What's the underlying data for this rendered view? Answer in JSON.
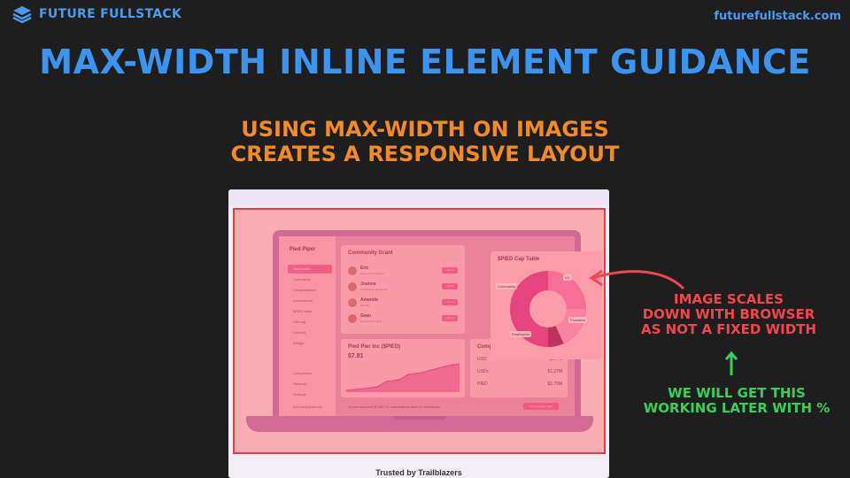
{
  "brand": {
    "name": "FUTURE FULLSTACK",
    "url": "futurefullstack.com"
  },
  "slide": {
    "title": "MAX-WIDTH INLINE ELEMENT GUIDANCE",
    "subtitle_line1": "USING MAX-WIDTH ON IMAGES",
    "subtitle_line2": "CREATES A RESPONSIVE LAYOUT",
    "note1": [
      "IMAGE SCALES",
      "DOWN WITH BROWSER",
      "AS NOT A FIXED WIDTH"
    ],
    "note2": [
      "WE WILL GET THIS",
      "WORKING LATER WITH %"
    ]
  },
  "colors": {
    "background": "#1e1e1e",
    "title": "#3b95f0",
    "subtitle": "#f28a26",
    "note_red": "#f2454f",
    "note_green": "#38d05a"
  },
  "screenshot": {
    "app_name": "Pied Piper",
    "nav": [
      "Dashboard",
      "Community",
      "Compensation",
      "Investments",
      "$PIED table",
      "Offering",
      "Content",
      "Widget",
      "Compliance",
      "Reviews",
      "Settings"
    ],
    "user": {
      "email": "john.doe@gmail.com",
      "role": "Administrator"
    },
    "grant": {
      "title": "Community Grant",
      "people": [
        {
          "name": "Eric",
          "desc": "Microsoft Contractor",
          "action": "Send"
        },
        {
          "name": "Joanna",
          "desc": "Outstanding developer",
          "action": "Send"
        },
        {
          "name": "Amanda",
          "desc": "Security",
          "action": "Send"
        },
        {
          "name": "Sean",
          "desc": "Completed 5 tasks",
          "action": "Send"
        }
      ]
    },
    "cap_table": {
      "title": "$PIED Cap Table",
      "labels": [
        "Community",
        "VC",
        "Founders",
        "Employees"
      ]
    },
    "pied": {
      "title": "Pied Pier Inc ($PIED)",
      "value": "$7.81",
      "ticks": [
        "Feb 16",
        "Jan 13",
        "Feb 13",
        "Mar 13",
        "Apr 13",
        "May 13"
      ]
    },
    "portfolio": {
      "title": "Company Portfolio",
      "rows": [
        {
          "name": "USD",
          "value": "$377K"
        },
        {
          "name": "USDc",
          "value": "$1.27M"
        },
        {
          "name": "PIED",
          "value": "$2.75M"
        }
      ]
    },
    "contrib_text": "You've received $7,897 of contributions from 11 individuals",
    "contrib_button": "Compensation table",
    "trusted": "Trusted by Trailblazers"
  }
}
